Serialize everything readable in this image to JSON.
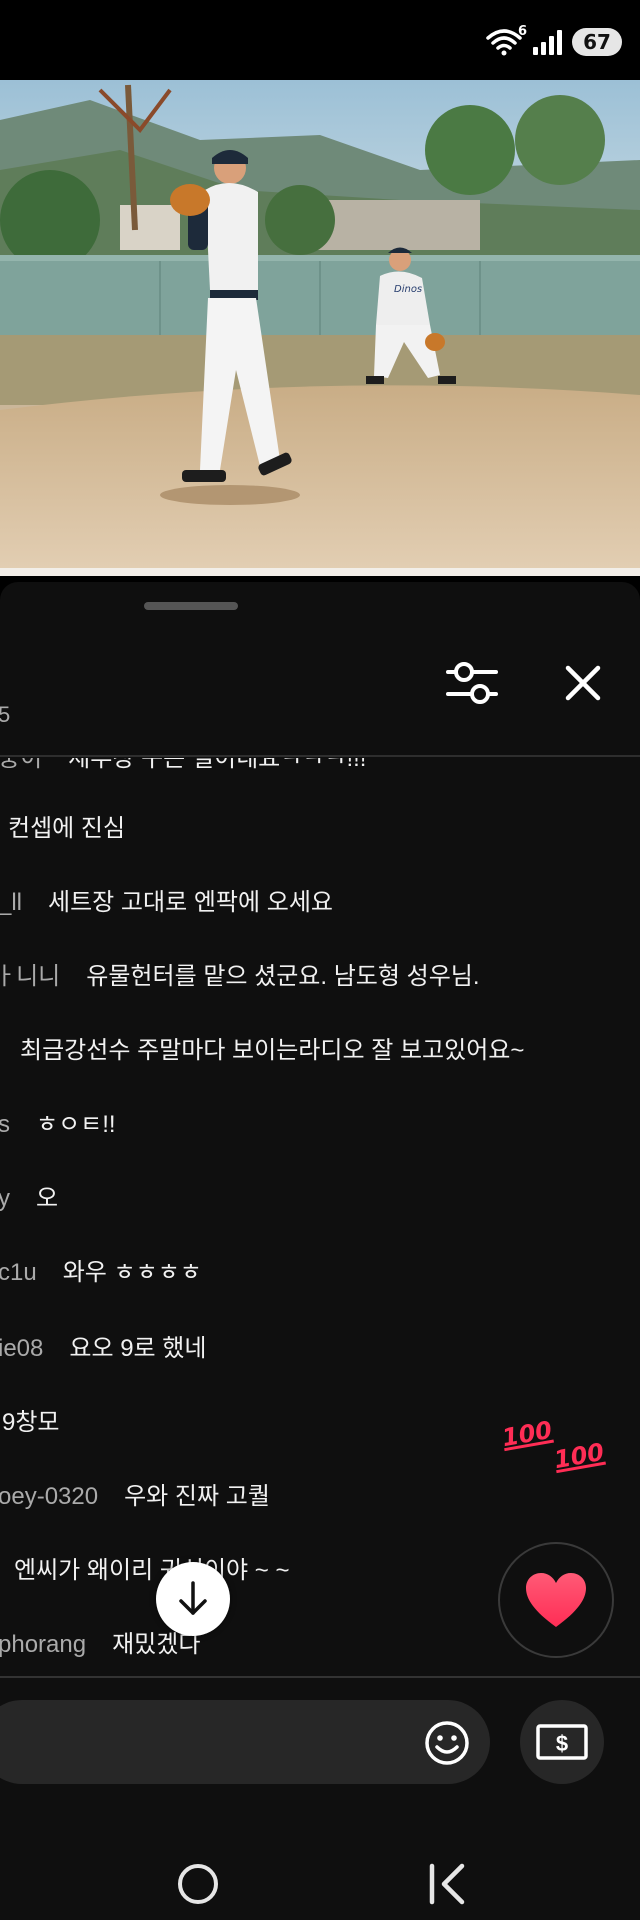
{
  "status_bar": {
    "wifi_label": "6",
    "battery": "67"
  },
  "chat": {
    "header_count": "5",
    "messages": [
      {
        "author": "중이",
        "text": "세부장 구든 밀이네요ㅋㅋㅋ!!!"
      },
      {
        "author": "",
        "text": "컨셉에 진심"
      },
      {
        "author": "_ll",
        "text": "세트장 고대로 엔팍에 오세요"
      },
      {
        "author": "ㅏ니니",
        "text": "유물헌터를 맡으 셨군요. 남도형 성우님."
      },
      {
        "author": "",
        "text": "최금강선수 주말마다 보이는라디오 잘 보고있어요~"
      },
      {
        "author": "s",
        "text": "ㅎㅇㅌ!!"
      },
      {
        "author": "y",
        "text": "오"
      },
      {
        "author": "c1u",
        "text": "와우 ㅎㅎㅎㅎ"
      },
      {
        "author": "ie08",
        "text": "요오 9로 했네"
      },
      {
        "author": "",
        "text": "9창모"
      },
      {
        "author": "oey-0320",
        "text": "우와 진짜 고퀄"
      },
      {
        "author": "",
        "text": "엔씨가 왜이리 귀신이야 ~ ~"
      },
      {
        "author": "phorang",
        "text": "재밌겠다"
      }
    ],
    "reactions": [
      "100",
      "100"
    ]
  },
  "icons": {
    "filter": "sliders-icon",
    "close": "close-icon",
    "scroll_down": "arrow-down-icon",
    "heart": "heart-icon",
    "emoji": "smiley-icon",
    "super_chat": "dollar-bill-icon"
  },
  "colors": {
    "panel_bg": "#0f0f0f",
    "author": "#aaaaaa",
    "text": "#f1f1f1",
    "heart": "#ff3b5c"
  }
}
